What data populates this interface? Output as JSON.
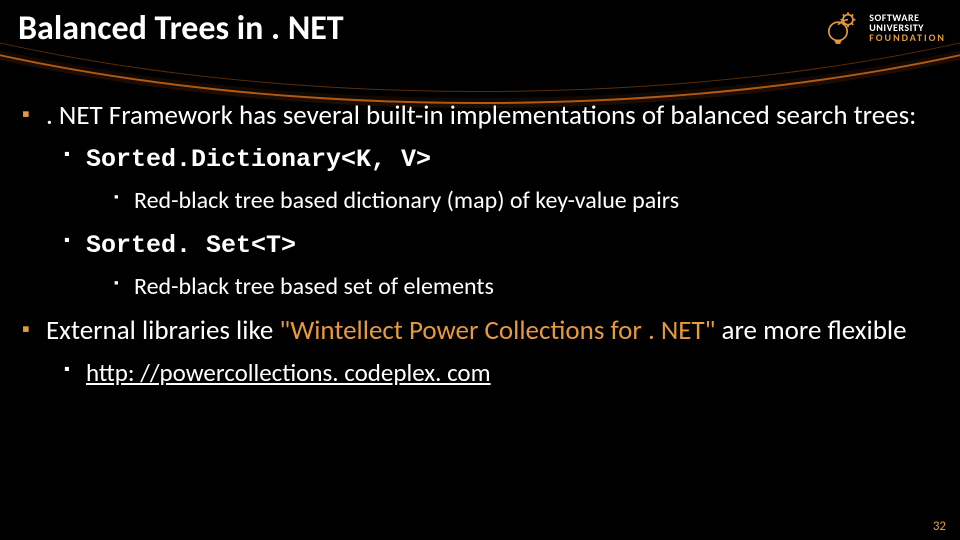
{
  "title": "Balanced Trees in . NET",
  "logo": {
    "line1": "SOFTWARE",
    "line2": "UNIVERSITY",
    "line3": "FOUNDATION"
  },
  "bullets": {
    "intro": ". NET Framework has several built-in implementations of balanced search trees:",
    "item1_code": "Sorted.Dictionary<K, V>",
    "item1_desc": "Red-black tree based dictionary (map) of key-value pairs",
    "item2_code": "Sorted. Set<T>",
    "item2_desc": "Red-black tree based set of elements",
    "external_prefix": "External libraries like ",
    "external_quote": "\"Wintellect Power Collections for . NET\"",
    "external_suffix": " are more flexible",
    "link": "http: //powercollections. codeplex. com"
  },
  "page_number": "32"
}
